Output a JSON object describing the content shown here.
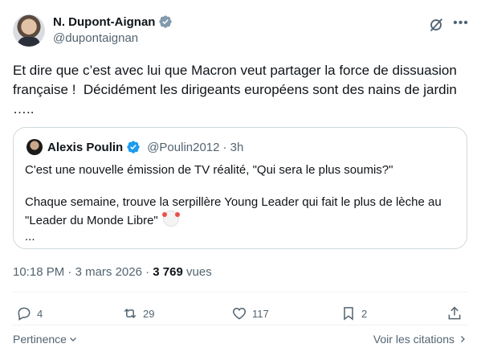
{
  "author": {
    "name": "N. Dupont-Aignan",
    "handle": "@dupontaignan",
    "verified": true
  },
  "tweet": {
    "text": "Et dire que c’est avec lui que Macron veut partager la force de dissuasion française !  Décidément les dirigeants européens sont des nains de jardin ….."
  },
  "quoted": {
    "name": "Alexis Poulin",
    "handle": "@Poulin2012",
    "time": "· 3h",
    "line1": "C'est une nouvelle émission de TV réalité, \"Qui sera le plus soumis?\"",
    "line2": "Chaque semaine, trouve la serpillère Young Leader qui fait le plus de lèche au \"Leader du Monde Libre\"",
    "more": "..."
  },
  "meta": {
    "time": "10:18 PM",
    "sep": "·",
    "date": "3 mars 2026",
    "views": "3 769",
    "views_label": "vues"
  },
  "actions": {
    "replies": "4",
    "reposts": "29",
    "likes": "117",
    "bookmarks": "2"
  },
  "footer": {
    "sort": "Pertinence",
    "quotes_link": "Voir les citations"
  },
  "colors": {
    "verified": "#1d9bf0",
    "muted": "#536471",
    "text": "#0f1419",
    "border": "#cfd9de"
  },
  "icons": [
    "verified-icon",
    "grok-icon",
    "more-icon",
    "reply-icon",
    "repost-icon",
    "like-icon",
    "bookmark-icon",
    "share-icon",
    "chevron-down-icon",
    "chevron-right-icon"
  ]
}
